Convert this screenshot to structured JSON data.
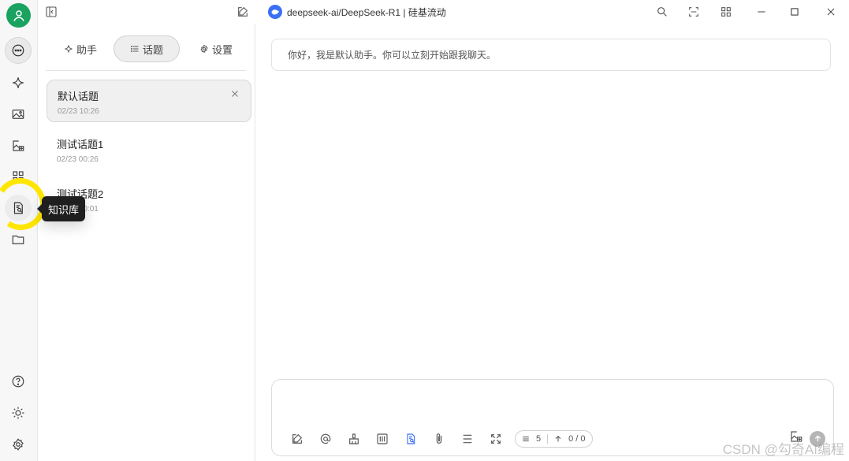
{
  "window": {
    "title": "deepseek-ai/DeepSeek-R1 | 硅基流动"
  },
  "rail": {
    "items": [
      {
        "name": "chat-icon"
      },
      {
        "name": "assistant-sparkle-icon"
      },
      {
        "name": "image-icon"
      },
      {
        "name": "image-edit-icon"
      },
      {
        "name": "apps-grid-icon"
      },
      {
        "name": "knowledge-base-icon"
      },
      {
        "name": "folder-icon"
      }
    ],
    "bottom": [
      {
        "name": "help-icon"
      },
      {
        "name": "theme-sun-icon"
      },
      {
        "name": "settings-icon"
      }
    ],
    "tooltip": "知识库"
  },
  "tabs": [
    {
      "label": "助手"
    },
    {
      "label": "话题"
    },
    {
      "label": "设置"
    }
  ],
  "topics": [
    {
      "name": "默认话题",
      "time": "02/23 10:26"
    },
    {
      "name": "测试话题1",
      "time": "02/23 00:26"
    },
    {
      "name": "测试话题2",
      "time": "02/23 00:01"
    }
  ],
  "chat": {
    "greeting": "你好，我是默认助手。你可以立刻开始跟我聊天。",
    "context_count": "5",
    "token_count": "0 / 0"
  },
  "watermark": "CSDN @勾奇AI编程",
  "colors": {
    "accent_green": "#1aa260",
    "brand_blue": "#3b6ff5",
    "highlight_yellow": "#ffe600"
  }
}
